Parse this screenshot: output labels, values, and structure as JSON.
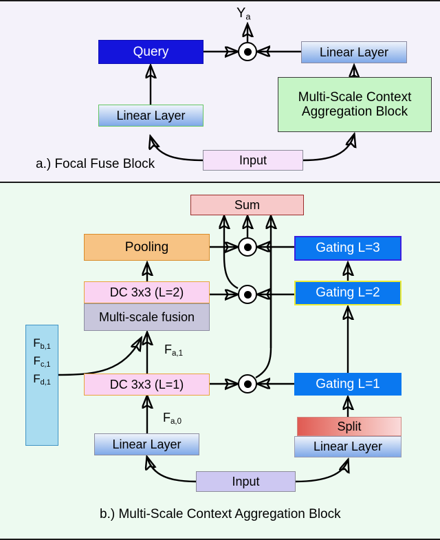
{
  "figure": {
    "panel_a": {
      "caption": "a.) Focal Fuse Block",
      "output_label": "Ya",
      "output_label_base": "Y",
      "output_label_sub": "a",
      "nodes": {
        "query": "Query",
        "linear_left": "Linear Layer",
        "linear_right": "Linear Layer",
        "msca_block": "Multi-Scale Context Aggregation Block",
        "msca_block_line1": "Multi-Scale Context",
        "msca_block_line2": "Aggregation Block",
        "input": "Input",
        "multiply": "element-wise-product"
      }
    },
    "panel_b": {
      "caption": "b.) Multi-Scale Context Aggregation Block",
      "nodes": {
        "sum": "Sum",
        "pooling": "Pooling",
        "dc_l2": "DC 3x3 (L=2)",
        "fusion": "Multi-scale fusion",
        "dc_l1": "DC 3x3 (L=1)",
        "linear_left": "Linear Layer",
        "linear_right": "Linear Layer",
        "split": "Split",
        "gating_l3": "Gating L=3",
        "gating_l2": "Gating L=2",
        "gating_l1": "Gating L=1",
        "input": "Input"
      },
      "feature_stack": {
        "f_b": {
          "base": "F",
          "sub": "b,1"
        },
        "f_c": {
          "base": "F",
          "sub": "c,1"
        },
        "f_d": {
          "base": "F",
          "sub": "d,1"
        }
      },
      "edge_labels": {
        "fa1": {
          "base": "F",
          "sub": "a,1"
        },
        "fa0": {
          "base": "F",
          "sub": "a,0"
        }
      }
    }
  },
  "colors": {
    "panel_a_bg": "#f4f2fa",
    "panel_b_bg": "#edfaf0",
    "query_fill": "#1414dc",
    "gating_fill": "#0a78f0",
    "sum_fill": "#f7c9c9",
    "sum_border": "#9b2b2b",
    "pooling_fill": "#f7c384",
    "pooling_border": "#d98b2a",
    "dc_fill": "#fad3f2",
    "dc_border": "#e8a33c",
    "fusion_fill": "#c8c6dc",
    "fusion_border": "#8c8ca0",
    "input_a_fill": "#f6e2fa",
    "input_b_fill": "#cdc8f2",
    "fstack_fill": "#a9dcf0",
    "fstack_border": "#3f93c4",
    "msca_fill": "#c6f5c6",
    "linear_top": "#eef3fb",
    "linear_bottom": "#7fa8e8",
    "split_left": "#e05a52",
    "split_right": "#fadada",
    "stroke": "#000000"
  }
}
